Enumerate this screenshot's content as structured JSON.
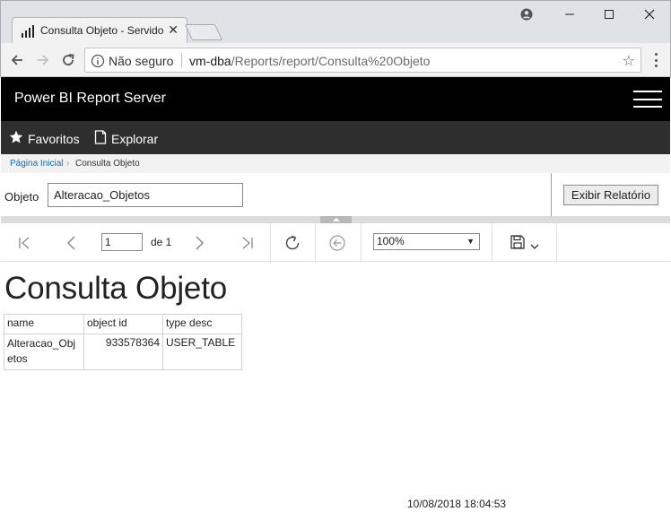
{
  "browser": {
    "tab_title": "Consulta Objeto - Servidor de Relatórios do Power BI",
    "security_label": "Não seguro",
    "url_host": "vm-dba",
    "url_path": "/Reports/report/Consulta%20Objeto"
  },
  "header": {
    "app_title": "Power BI Report Server"
  },
  "nav": {
    "favorites_label": "Favoritos",
    "explore_label": "Explorar"
  },
  "breadcrumb": {
    "home": "Página Inicial",
    "separator": "›",
    "current": "Consulta Objeto"
  },
  "parameters": {
    "objeto_label": "Objeto",
    "objeto_value": "Alteracao_Objetos",
    "view_report_label": "Exibir Relatório"
  },
  "report_toolbar": {
    "page_current": "1",
    "page_of": "de 1",
    "zoom": "100%"
  },
  "report": {
    "title": "Consulta Objeto",
    "columns": [
      "name",
      "object id",
      "type desc"
    ],
    "rows": [
      [
        "Alteracao_Objetos",
        "933578364",
        "USER_TABLE"
      ]
    ],
    "timestamp": "10/08/2018 18:04:53"
  }
}
